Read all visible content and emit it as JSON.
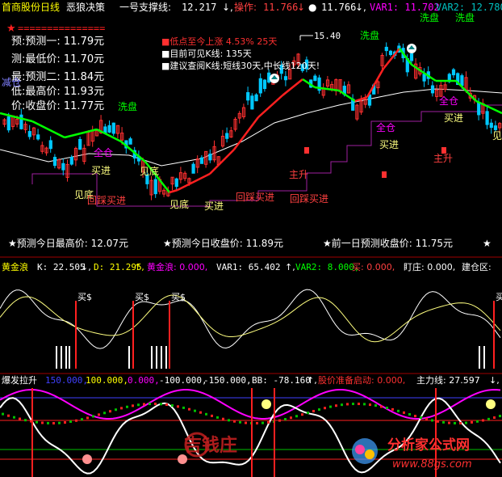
{
  "header": {
    "title": "首商股份日线",
    "indicator_name": "恶狼决策",
    "support_label": "一号支撑线:",
    "support_value": "12.217",
    "op_label": "操作:",
    "op_value": "11.766",
    "op_value2": "11.766",
    "var1": "VAR1: 11.702",
    "var2": "VAR2: 12.780",
    "wash_label": "洗盘"
  },
  "info_left": {
    "lines": [
      "预:预测一: 11.79元",
      "测:最低价: 11.70元",
      "最:预测二: 11.84元",
      "低:最高价: 11.93元",
      "价:收盘价: 11.77元"
    ]
  },
  "info_box": {
    "line1": "■低点至今上涨 4.53%   25天",
    "line2": "■目前可见K线: 135天",
    "line3": "■建议查阅K线:短线30天,中长线120天!"
  },
  "price_marker": "15.40",
  "chart_labels": {
    "reduce": "减仓",
    "wash1": "洗盘",
    "wash2": "洗盘",
    "full1": "全仓",
    "full2": "全仓",
    "full3": "全仓",
    "buy1": "买进",
    "buy2": "买进",
    "buy3": "买进",
    "buy4": "买进",
    "see_bottom1": "见底",
    "see_bottom2": "见底",
    "see_bottom3": "见底",
    "pullback1": "回踩买进",
    "pullback2": "回踩买进",
    "pullback3": "回踩买进",
    "rise1": "主升",
    "rise2": "主升",
    "see_top": "见"
  },
  "forecast_bar": {
    "high": "★预测今日最高价: 12.07元",
    "close": "★预测今日收盘价: 11.89元",
    "prev": "★前一日预测收盘价: 11.75元"
  },
  "panel2": {
    "name": "黄金浪",
    "k": "K: 22.505",
    "d": "D: 21.295",
    "gold": "黄金浪: 0.000,",
    "var1": "VAR1: 65.402",
    "var2": "VAR2: 8.000,",
    "buy": "买: 0.000,",
    "bank": "盯庄: 0.000,",
    "build": "建仓区:",
    "buy_signal": "买$"
  },
  "panel3": {
    "name": "爆发拉升",
    "v150": "150.000,",
    "v100": "100.000,",
    "v0": "0.000,",
    "vm100": "-100.000,",
    "vm150": "-150.000,",
    "bb": "BB: -78.160",
    "ready": "股价准备启动: 0.000,",
    "main": "主力线: 27.597",
    "watermark": "吉钱庄",
    "site_name": "分析家公式网",
    "site_url": "www.88gs.com"
  },
  "colors": {
    "bg": "#000000",
    "up": "#ff3030",
    "down": "#00c8ff",
    "red_line": "#ff2020",
    "green_line": "#00ff00",
    "white_line": "#ffffff",
    "purple": "#c000c0",
    "yellow": "#ffff00",
    "cyan": "#00c0c0",
    "magenta": "#ff00ff"
  }
}
